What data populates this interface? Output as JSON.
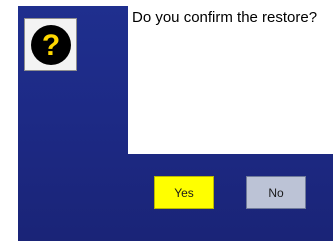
{
  "dialog": {
    "icon": "question-icon",
    "message": "Do you confirm the restore?",
    "buttons": {
      "yes_label": "Yes",
      "no_label": "No"
    }
  },
  "colors": {
    "background": "#1d2a86",
    "icon_circle": "#000000",
    "icon_glyph": "#ffd800",
    "yes_button": "#ffff00",
    "no_button": "#bcc3d6"
  }
}
